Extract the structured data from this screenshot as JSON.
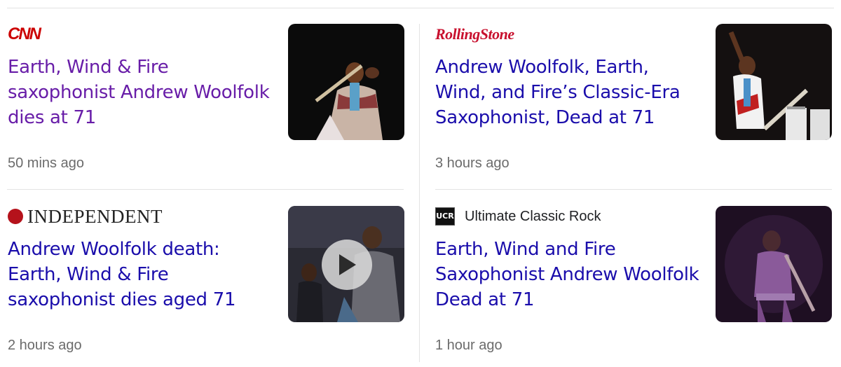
{
  "articles": [
    {
      "source": "CNN",
      "headline": "Earth, Wind & Fire saxophonist Andrew Woolfolk dies at 71",
      "time": "50 mins ago",
      "visited": true
    },
    {
      "source": "RollingStone",
      "headline": "Andrew Woolfolk, Earth, Wind, and Fire’s Classic-Era Saxophonist, Dead at 71",
      "time": "3 hours ago",
      "visited": false
    },
    {
      "source": "INDEPENDENT",
      "headline": "Andrew Woolfolk death: Earth, Wind & Fire saxophonist dies aged 71",
      "time": "2 hours ago",
      "visited": false,
      "has_video": true
    },
    {
      "source": "Ultimate Classic Rock",
      "source_badge": "UCR",
      "headline": "Earth, Wind and Fire Saxophonist Andrew Woolfolk Dead at 71",
      "time": "1 hour ago",
      "visited": false
    }
  ],
  "colors": {
    "visited_link": "#681da8",
    "link": "#1a0dab",
    "timestamp": "#6b6b6b",
    "divider": "#e3e3e3"
  }
}
